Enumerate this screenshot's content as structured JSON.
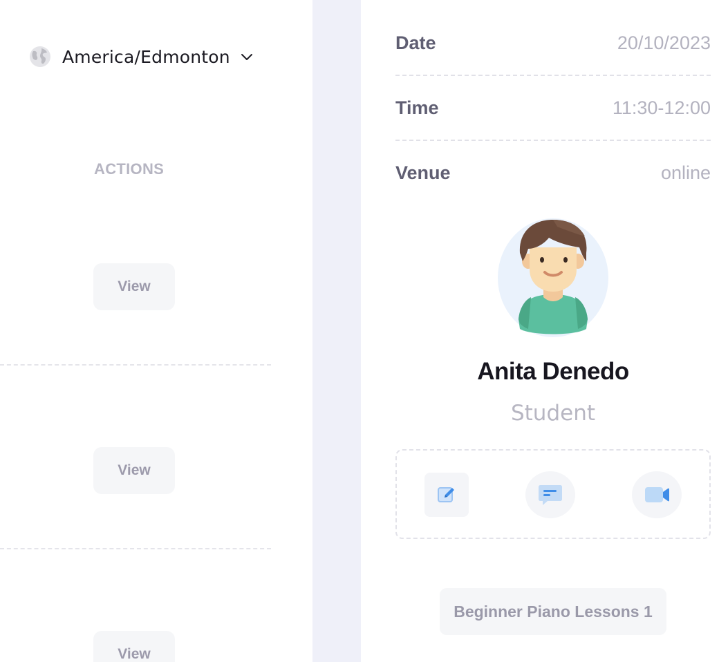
{
  "timezone": {
    "label": "America/Edmonton",
    "icon": "globe-icon"
  },
  "actions_column": {
    "header": "ACTIONS",
    "rows": [
      {
        "button_label": "View"
      },
      {
        "button_label": "View"
      },
      {
        "button_label": "View"
      }
    ]
  },
  "details": {
    "date": {
      "label": "Date",
      "value": "20/10/2023"
    },
    "time": {
      "label": "Time",
      "value": "11:30-12:00"
    },
    "venue": {
      "label": "Venue",
      "value": "online"
    }
  },
  "person": {
    "name": "Anita Denedo",
    "role": "Student",
    "avatar": "avatar-boy-illustration"
  },
  "quick_actions": [
    {
      "name": "edit",
      "icon": "edit-icon"
    },
    {
      "name": "message",
      "icon": "chat-icon"
    },
    {
      "name": "video-call",
      "icon": "video-icon"
    }
  ],
  "course": {
    "label": "Beginner Piano Lessons 1"
  },
  "colors": {
    "accent_blue": "#4a90e2",
    "strip": "#eff0f9",
    "muted_text": "#b3b2bf",
    "label_text": "#5f5e72"
  }
}
